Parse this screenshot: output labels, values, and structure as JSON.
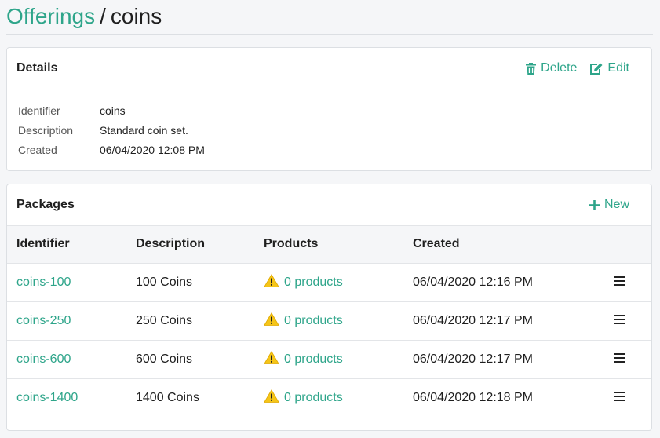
{
  "breadcrumb": {
    "parent": "Offerings",
    "separator": "/",
    "current": "coins"
  },
  "details": {
    "title": "Details",
    "delete_label": "Delete",
    "edit_label": "Edit",
    "rows": [
      {
        "key": "Identifier",
        "value": "coins"
      },
      {
        "key": "Description",
        "value": "Standard coin set."
      },
      {
        "key": "Created",
        "value": "06/04/2020 12:08 PM"
      }
    ]
  },
  "packages": {
    "title": "Packages",
    "new_label": "New",
    "columns": [
      "Identifier",
      "Description",
      "Products",
      "Created"
    ],
    "rows": [
      {
        "identifier": "coins-100",
        "description": "100 Coins",
        "products": "0 products",
        "created": "06/04/2020 12:16 PM"
      },
      {
        "identifier": "coins-250",
        "description": "250 Coins",
        "products": "0 products",
        "created": "06/04/2020 12:17 PM"
      },
      {
        "identifier": "coins-600",
        "description": "600 Coins",
        "products": "0 products",
        "created": "06/04/2020 12:17 PM"
      },
      {
        "identifier": "coins-1400",
        "description": "1400 Coins",
        "products": "0 products",
        "created": "06/04/2020 12:18 PM"
      }
    ]
  },
  "icons": {
    "delete": "trash-icon",
    "edit": "edit-icon",
    "new": "plus-icon",
    "warning": "warning-icon",
    "menu": "hamburger-menu-icon"
  },
  "colors": {
    "accent": "#2ea58a",
    "warning": "#f5c518"
  }
}
